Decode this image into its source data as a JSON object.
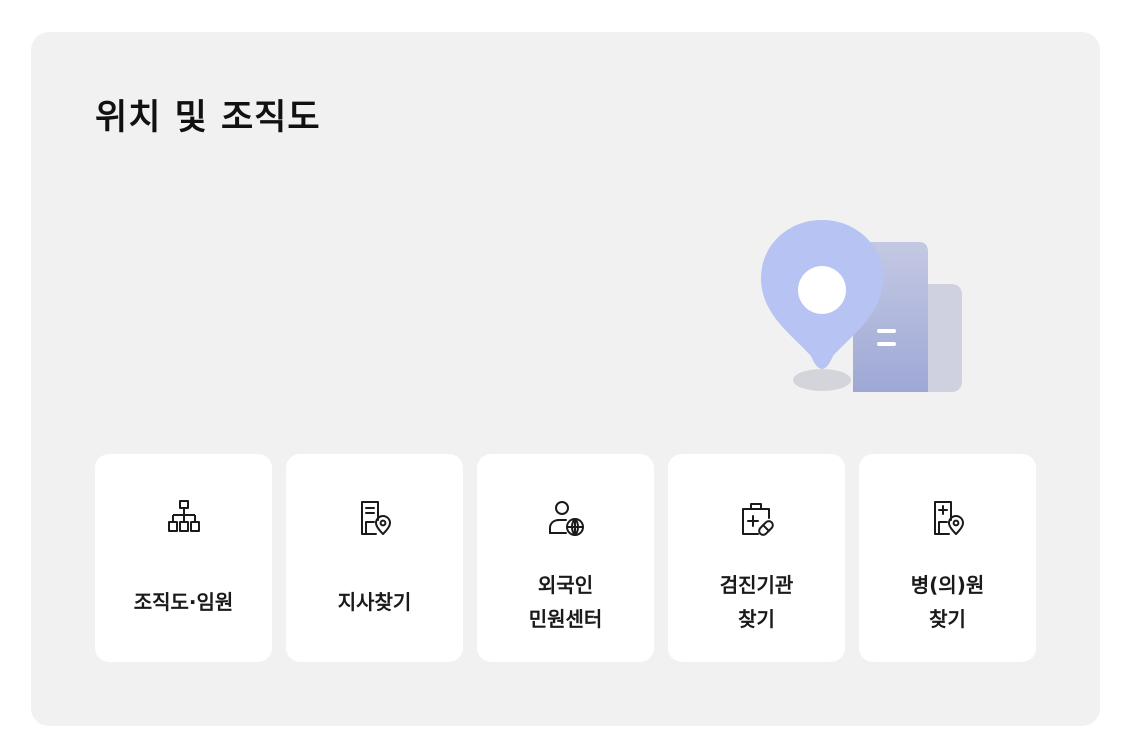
{
  "section": {
    "title": "위치 및 조직도"
  },
  "illustration": {
    "icon": "map-pin-building-icon"
  },
  "cards": [
    {
      "icon": "org-chart-icon",
      "line1": "조직도·임원",
      "line2": ""
    },
    {
      "icon": "branch-document-pin-icon",
      "line1": "지사찾기",
      "line2": ""
    },
    {
      "icon": "person-globe-icon",
      "line1": "외국인",
      "line2": "민원센터"
    },
    {
      "icon": "medical-kit-pill-icon",
      "line1": "검진기관",
      "line2": "찾기"
    },
    {
      "icon": "hospital-pin-icon",
      "line1": "병(의)원",
      "line2": "찾기"
    }
  ],
  "colors": {
    "panel_bg": "#f1f1f2",
    "card_bg": "#ffffff",
    "pin": "#b7c3f2",
    "building_front": "#a5aed6",
    "building_back": "#cfd1e1"
  }
}
